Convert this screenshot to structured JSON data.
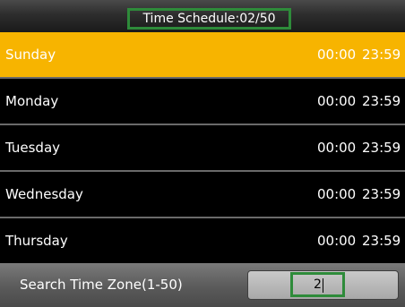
{
  "header": {
    "title": "Time Schedule:02/50"
  },
  "schedule": {
    "rows": [
      {
        "day": "Sunday",
        "start": "00:00",
        "end": "23:59",
        "selected": true
      },
      {
        "day": "Monday",
        "start": "00:00",
        "end": "23:59",
        "selected": false
      },
      {
        "day": "Tuesday",
        "start": "00:00",
        "end": "23:59",
        "selected": false
      },
      {
        "day": "Wednesday",
        "start": "00:00",
        "end": "23:59",
        "selected": false
      },
      {
        "day": "Thursday",
        "start": "00:00",
        "end": "23:59",
        "selected": false
      }
    ]
  },
  "search": {
    "label": "Search Time Zone(1-50)",
    "value": "2"
  },
  "colors": {
    "selected_row": "#f7b400",
    "highlight_frame": "#2e8b3a",
    "row_background": "#000000"
  }
}
